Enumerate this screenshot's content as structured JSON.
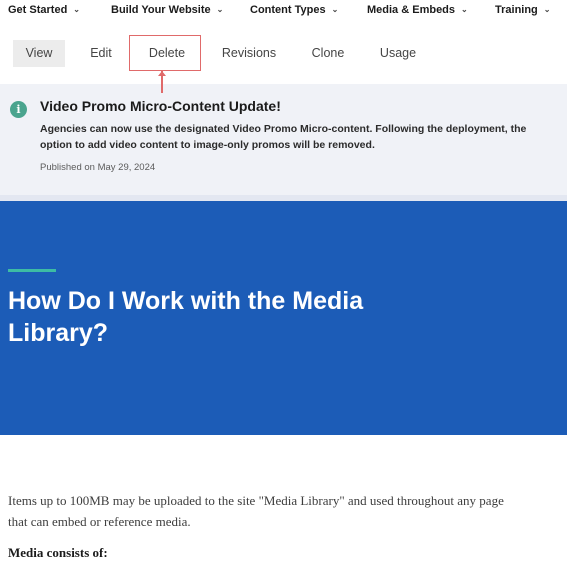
{
  "topnav": {
    "items": [
      {
        "label": "Get Started"
      },
      {
        "label": "Build Your Website"
      },
      {
        "label": "Content Types"
      },
      {
        "label": "Media & Embeds"
      },
      {
        "label": "Training"
      }
    ],
    "chevron_glyph": "⌄"
  },
  "tabs": [
    {
      "label": "View",
      "active": true
    },
    {
      "label": "Edit"
    },
    {
      "label": "Delete",
      "highlighted": true
    },
    {
      "label": "Revisions"
    },
    {
      "label": "Clone"
    },
    {
      "label": "Usage"
    }
  ],
  "alert": {
    "icon": "info-icon",
    "icon_glyph": "i",
    "title": "Video Promo Micro-Content Update!",
    "body": "Agencies can now use the designated Video Promo Micro-content. Following the deployment, the option to add video content to image-only promos will be removed.",
    "published": "Published on May 29, 2024"
  },
  "hero": {
    "title": "How Do I Work with the Media Library?"
  },
  "content": {
    "intro": "Items up to 100MB may be uploaded to the site \"Media Library\" and used throughout any page that can embed or reference media.",
    "media_heading": "Media consists of:"
  },
  "colors": {
    "hero_bg": "#1c5cb7",
    "accent": "#3dbca4",
    "info_icon": "#4aa48e",
    "alert_bg": "#f0f2f7",
    "highlight": "#e06a6a"
  }
}
